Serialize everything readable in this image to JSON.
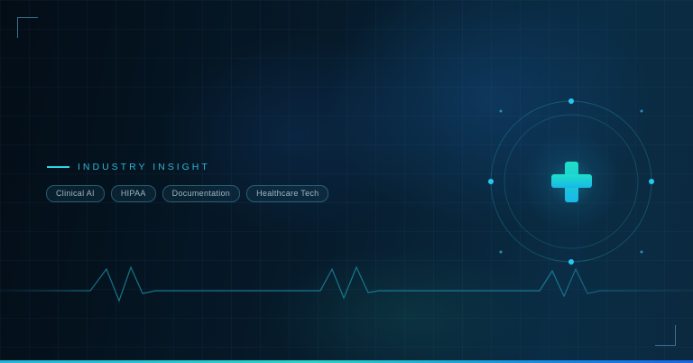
{
  "eyebrow": {
    "label": "INDUSTRY INSIGHT"
  },
  "tags": [
    "Clinical AI",
    "HIPAA",
    "Documentation",
    "Healthcare Tech"
  ],
  "icons": {
    "emblem": "medical-cross-icon"
  },
  "colors": {
    "accent": "#2fd4e6",
    "cross_top": "#1fe0c8",
    "cross_bottom": "#18b7e8",
    "background": "#041420"
  }
}
